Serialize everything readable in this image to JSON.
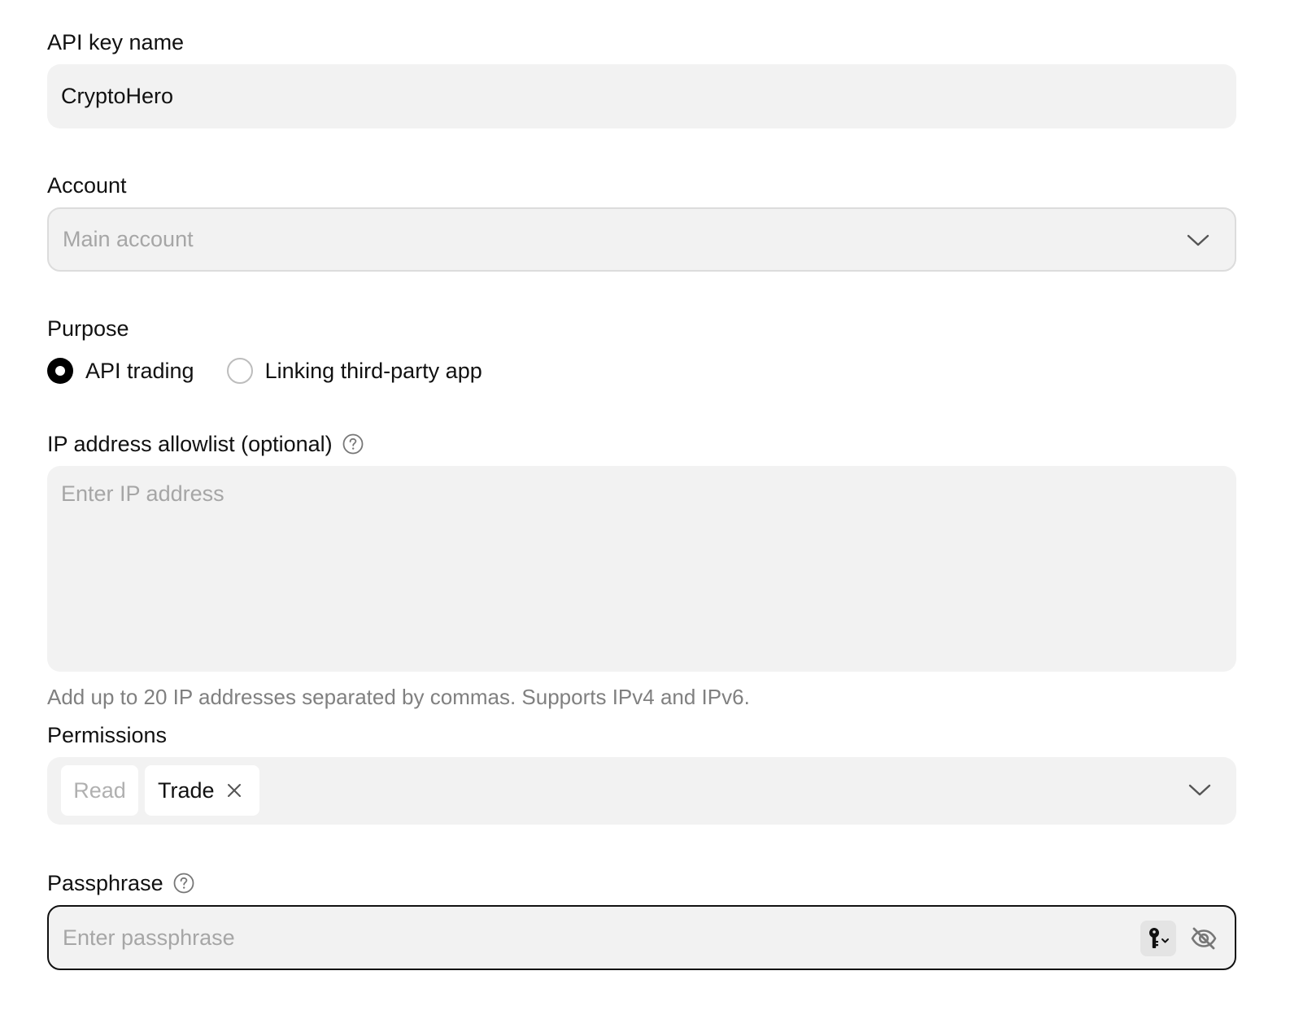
{
  "api_key_name": {
    "label": "API key name",
    "value": "CryptoHero"
  },
  "account": {
    "label": "Account",
    "placeholder": "Main account",
    "icon": "chevron-down-icon"
  },
  "purpose": {
    "label": "Purpose",
    "options": [
      {
        "label": "API trading",
        "selected": true
      },
      {
        "label": "Linking third-party app",
        "selected": false
      }
    ]
  },
  "ip_allowlist": {
    "label": "IP address allowlist (optional)",
    "placeholder": "Enter IP address",
    "helper": "Add up to 20 IP addresses separated by commas. Supports IPv4 and IPv6.",
    "icon": "help-icon"
  },
  "permissions": {
    "label": "Permissions",
    "chips": [
      {
        "label": "Read",
        "removable": false,
        "disabled": true
      },
      {
        "label": "Trade",
        "removable": true,
        "disabled": false
      }
    ],
    "icon": "chevron-down-icon"
  },
  "passphrase": {
    "label": "Passphrase",
    "placeholder": "Enter passphrase",
    "icons": [
      "help-icon",
      "key-icon",
      "eye-off-icon"
    ]
  }
}
